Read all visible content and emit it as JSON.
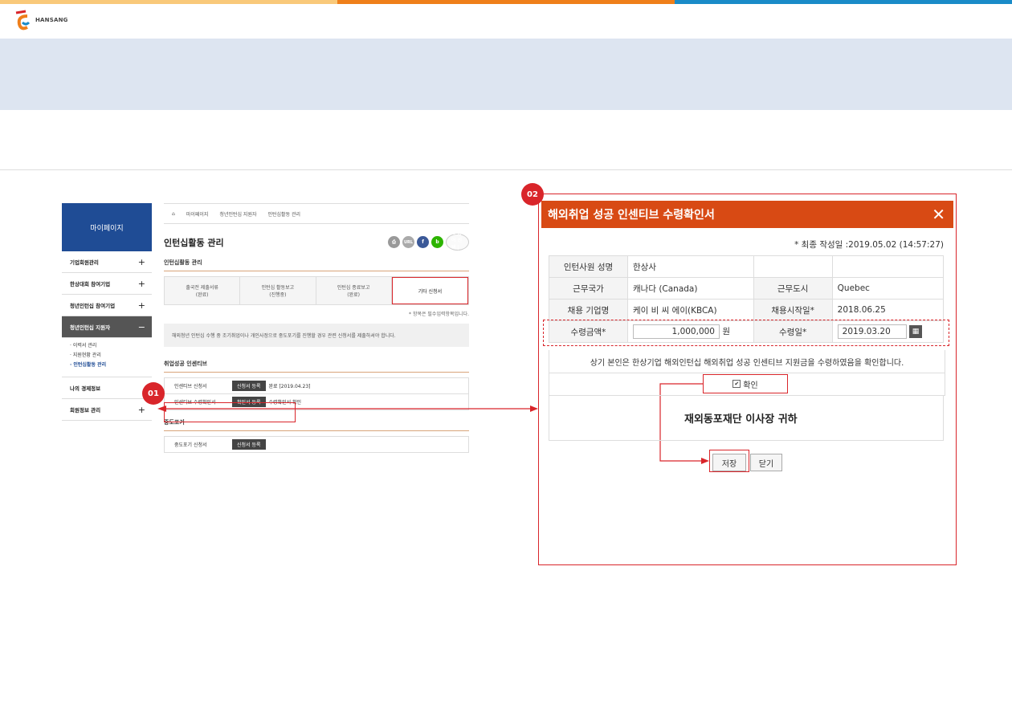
{
  "brand": {
    "logo_text": "HANSANG",
    "bar_colors": [
      "#f9c97a",
      "#ef7f1a",
      "#1a8bc8"
    ]
  },
  "left": {
    "side_title": "마이페이지",
    "side_items": [
      {
        "label": "기업회원관리",
        "toggle": "+"
      },
      {
        "label": "한상대회 참여기업",
        "toggle": "+"
      },
      {
        "label": "청년인턴십 참여기업",
        "toggle": "+"
      },
      {
        "label": "청년인턴십 지원자",
        "toggle": "−"
      }
    ],
    "sub_items": [
      "· 이력서 관리",
      "· 지원현황 관리",
      "· 인턴십활동 관리"
    ],
    "side_items2": [
      {
        "label": "나의 경제정보",
        "toggle": ""
      },
      {
        "label": "회원정보 관리",
        "toggle": "+"
      }
    ],
    "breadcrumb": [
      "마이페이지",
      "청년인턴십 지원자",
      "인턴십활동 관리"
    ],
    "page_title": "인턴십활동 관리",
    "share": [
      "인쇄",
      "URL",
      "f",
      "b"
    ],
    "lang": "G 언어 선택 | ▼",
    "section1": "인턴십활동 관리",
    "steps": [
      {
        "line1": "출국전 제출서류",
        "line2": "(완료)"
      },
      {
        "line1": "인턴십 활동보고",
        "line2": "(진행중)"
      },
      {
        "line1": "인턴십 종료보고",
        "line2": "(완료)"
      },
      {
        "line1": "기타 신청서",
        "line2": ""
      }
    ],
    "required_note": "* 항목은 필수입력항목입니다.",
    "notice": "해외청년 인턴십 수행 중 조기취업이나 개인사정으로 중도포기를 진행할 경우 관련 신청서를 제출하셔야 합니다.",
    "section2": "취업성공 인센티브",
    "rows1": [
      {
        "label": "인센티브 신청서",
        "button": "신청서 등록",
        "status": "완료 [2019.04.23]"
      },
      {
        "label": "인센티브 수령확인서",
        "button": "확인서 등록",
        "status": "수령확인서 확인"
      }
    ],
    "section3": "중도포기",
    "rows2": [
      {
        "label": "중도포기 신청서",
        "button": "신청서 등록",
        "status": ""
      }
    ]
  },
  "badges": {
    "b1": "01",
    "b2": "02"
  },
  "popup": {
    "title": "해외취업 성공 인센티브 수령확인서",
    "close": "✕",
    "date": "* 최종 작성일 :2019.05.02 (14:57:27)",
    "fields": {
      "name_label": "인턴사원 성명",
      "name_value": "한상사",
      "country_label": "근무국가",
      "country_value": "캐나다 (Canada)",
      "city_label": "근무도시",
      "city_value": "Quebec",
      "company_label": "채용 기업명",
      "company_value": "케이 비 씨 에이(KBCA)",
      "start_label": "채용시작일*",
      "start_value": "2018.06.25",
      "amount_label": "수령금액*",
      "amount_value": "1,000,000",
      "amount_unit": "원",
      "recv_label": "수령일*",
      "recv_value": "2019.03.20"
    },
    "confirm_text": "상기 본인은 한상기업 해외인턴십 해외취업 성공 인센티브 지원금을 수령하였음을 확인합니다.",
    "checkbox_label": "확인",
    "checkbox_checked": true,
    "recipient": "재외동포재단 이사장 귀하",
    "save_label": "저장",
    "close_label": "닫기"
  }
}
